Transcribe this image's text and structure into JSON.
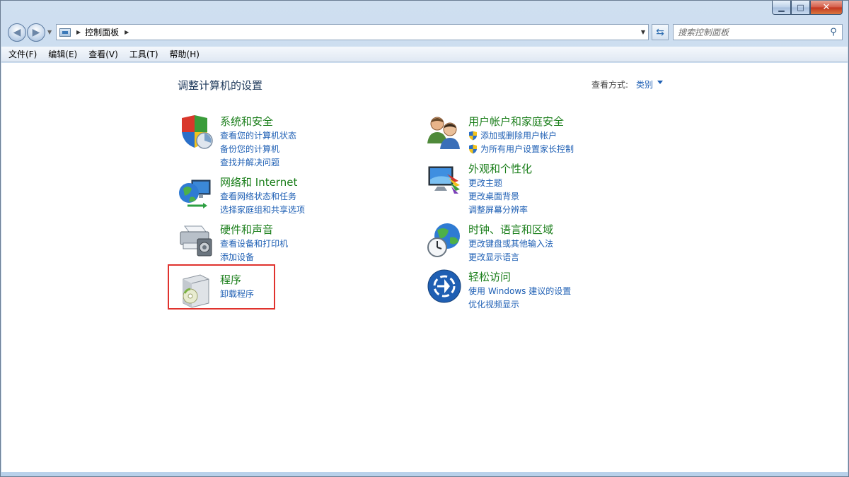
{
  "window": {
    "caption": {
      "minimize": "▁",
      "maximize": "□",
      "close": "✕"
    }
  },
  "nav": {
    "back_icon": "back-arrow-icon",
    "forward_icon": "forward-arrow-icon",
    "breadcrumb": "控制面板",
    "search_placeholder": "搜索控制面板"
  },
  "menu": {
    "items": [
      "文件(F)",
      "编辑(E)",
      "查看(V)",
      "工具(T)",
      "帮助(H)"
    ]
  },
  "content": {
    "title": "调整计算机的设置",
    "view_label": "查看方式:",
    "view_value": "类别"
  },
  "categories": {
    "system": {
      "title": "系统和安全",
      "links": [
        "查看您的计算机状态",
        "备份您的计算机",
        "查找并解决问题"
      ]
    },
    "network": {
      "title": "网络和 Internet",
      "links": [
        "查看网络状态和任务",
        "选择家庭组和共享选项"
      ]
    },
    "hardware": {
      "title": "硬件和声音",
      "links": [
        "查看设备和打印机",
        "添加设备"
      ]
    },
    "programs": {
      "title": "程序",
      "links": [
        "卸载程序"
      ]
    },
    "users": {
      "title": "用户帐户和家庭安全",
      "links": [
        "添加或删除用户帐户",
        "为所有用户设置家长控制"
      ]
    },
    "appearance": {
      "title": "外观和个性化",
      "links": [
        "更改主题",
        "更改桌面背景",
        "调整屏幕分辨率"
      ]
    },
    "clock": {
      "title": "时钟、语言和区域",
      "links": [
        "更改键盘或其他输入法",
        "更改显示语言"
      ]
    },
    "access": {
      "title": "轻松访问",
      "links": [
        "使用 Windows 建议的设置",
        "优化视频显示"
      ]
    }
  },
  "colors": {
    "category_title": "#1a7e1a",
    "link": "#1e5fb4",
    "highlight": "#e0322d"
  }
}
